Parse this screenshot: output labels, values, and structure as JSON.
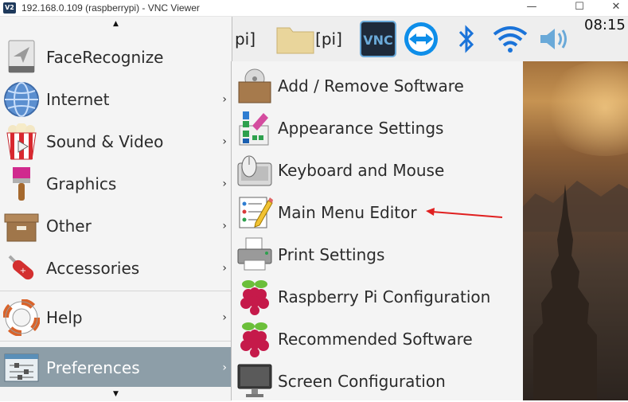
{
  "window": {
    "title": "192.168.0.109 (raspberrypi) - VNC Viewer",
    "logo_text": "V2",
    "minimize": "—",
    "maximize": "☐",
    "close": "✕"
  },
  "panel": {
    "partial_label": "pi]",
    "folder_label": "[pi]",
    "clock": "08:15"
  },
  "main_menu": {
    "scroll_up": "▲",
    "scroll_down": "▼",
    "items": [
      {
        "label": "FaceRecognize",
        "icon": "paper-plane-icon",
        "has_submenu": false
      },
      {
        "label": "Internet",
        "icon": "globe-icon",
        "has_submenu": true
      },
      {
        "label": "Sound & Video",
        "icon": "popcorn-icon",
        "has_submenu": true
      },
      {
        "label": "Graphics",
        "icon": "paintbrush-icon",
        "has_submenu": true
      },
      {
        "label": "Other",
        "icon": "box-icon",
        "has_submenu": true
      },
      {
        "label": "Accessories",
        "icon": "swiss-knife-icon",
        "has_submenu": true
      },
      {
        "label": "Help",
        "icon": "lifebuoy-icon",
        "has_submenu": true
      },
      {
        "label": "Preferences",
        "icon": "settings-sliders-icon",
        "has_submenu": true,
        "selected": true
      }
    ],
    "chevron": "›"
  },
  "submenu": {
    "items": [
      {
        "label": "Add / Remove Software",
        "icon": "package-cd-icon"
      },
      {
        "label": "Appearance Settings",
        "icon": "color-swatch-icon"
      },
      {
        "label": "Keyboard and Mouse",
        "icon": "keyboard-mouse-icon"
      },
      {
        "label": "Main Menu Editor",
        "icon": "menu-editor-icon"
      },
      {
        "label": "Print Settings",
        "icon": "printer-icon"
      },
      {
        "label": "Raspberry Pi Configuration",
        "icon": "raspberry-icon"
      },
      {
        "label": "Recommended Software",
        "icon": "raspberry-icon"
      },
      {
        "label": "Screen Configuration",
        "icon": "monitor-icon"
      }
    ]
  },
  "colors": {
    "selected_bg": "#8d9ea8",
    "menu_bg": "#f4f4f4",
    "annotation_arrow": "#e02020"
  }
}
